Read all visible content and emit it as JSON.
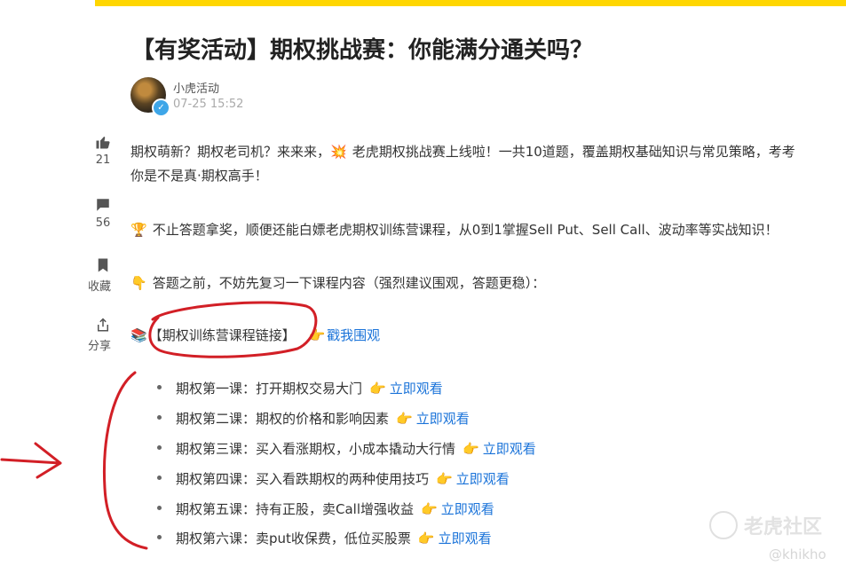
{
  "post": {
    "title": "【有奖活动】期权挑战赛：你能满分通关吗？",
    "author": "小虎活动",
    "time": "07-25 15:52",
    "verified_badge": "✓"
  },
  "sidebar": {
    "like": {
      "icon": "thumbs-up-icon",
      "count": "21"
    },
    "comment": {
      "icon": "comment-icon",
      "count": "56"
    },
    "bookmark": {
      "icon": "bookmark-icon",
      "label": "收藏"
    },
    "share": {
      "icon": "share-icon",
      "label": "分享"
    }
  },
  "body": {
    "p1_line1_a": "期权萌新？期权老司机？来来来，",
    "p1_line1_b": "老虎期权挑战赛上线啦！一共10道题，覆盖期权基础知识与常见策略，考考",
    "p1_line2": "你是不是真·期权高手！",
    "p2": "不止答题拿奖，顺便还能白嫖老虎期权训练营课程，从0到1掌握Sell Put、Sell Call、波动率等实战知识！",
    "p3": "答题之前，不妨先复习一下课程内容（强烈建议围观，答题更稳）：",
    "course_link_label": "【期权训练营课程链接】",
    "course_link_action": "戳我围观",
    "emoji": {
      "boom": "💥",
      "trophy": "🏆",
      "point_down": "👇",
      "books": "📚",
      "point_right": "👉"
    }
  },
  "lessons": [
    {
      "text": "期权第一课：打开期权交易大门",
      "action": "立即观看"
    },
    {
      "text": "期权第二课：期权的价格和影响因素",
      "action": "立即观看"
    },
    {
      "text": "期权第三课：买入看涨期权，小成本撬动大行情",
      "action": "立即观看"
    },
    {
      "text": "期权第四课：买入看跌期权的两种使用技巧",
      "action": "立即观看"
    },
    {
      "text": "期权第五课：持有正股，卖Call增强收益",
      "action": "立即观看"
    },
    {
      "text": "期权第六课：卖put收保费，低位买股票",
      "action": "立即观看"
    }
  ],
  "watermark": {
    "brand": "老虎社区",
    "user": "@khikho"
  },
  "colors": {
    "accent_bar": "#ffd600",
    "link": "#1a73d9",
    "annotation": "#d21f26"
  }
}
